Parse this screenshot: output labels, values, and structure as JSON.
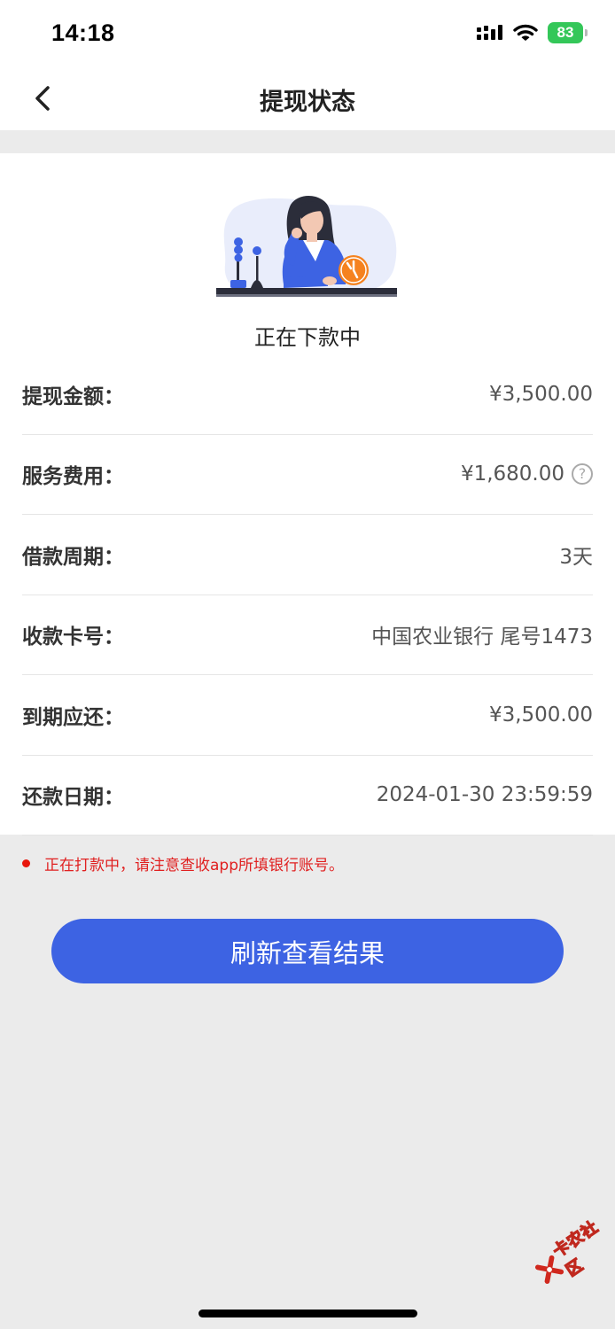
{
  "status_bar": {
    "time": "14:18",
    "battery": "83"
  },
  "nav": {
    "title": "提现状态"
  },
  "status": {
    "label": "正在下款中"
  },
  "details": [
    {
      "label": "提现金额：",
      "value": "¥3,500.00"
    },
    {
      "label": "服务费用：",
      "value": "¥1,680.00"
    },
    {
      "label": "借款周期：",
      "value": "3天"
    },
    {
      "label": "收款卡号：",
      "value": "中国农业银行 尾号1473"
    },
    {
      "label": "到期应还：",
      "value": "¥3,500.00"
    },
    {
      "label": "还款日期：",
      "value": "2024-01-30 23:59:59"
    }
  ],
  "notice": {
    "text": "正在打款中，请注意查收app所填银行账号。"
  },
  "actions": {
    "refresh_label": "刷新查看结果"
  },
  "watermark": {
    "text": "卡农社区"
  },
  "colors": {
    "primary": "#3d63e3",
    "alert": "#e8160c",
    "battery": "#34c759",
    "illustration_accent": "#f5821f"
  }
}
